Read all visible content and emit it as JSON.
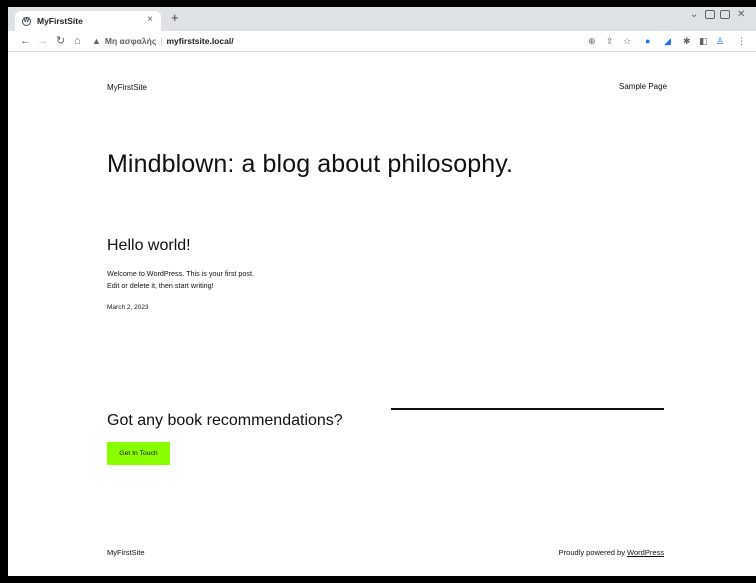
{
  "browser": {
    "tab": {
      "title": "MyFirstSite",
      "close": "×"
    },
    "new_tab": "+",
    "omnibox": {
      "security_label": "Μη ασφαλής",
      "separator": "|",
      "url": "myfirstsite.local/"
    }
  },
  "site": {
    "title": "MyFirstSite",
    "nav": [
      "Sample Page"
    ],
    "hero": "Mindblown: a blog about philosophy.",
    "post": {
      "title": "Hello world!",
      "excerpt_line1": "Welcome to WordPress. This is your first post.",
      "excerpt_line2": "Edit or delete it, then start writing!",
      "date": "March 2, 2023"
    },
    "cta": {
      "heading": "Got any book recommendations?",
      "button": "Get In Touch",
      "button_color": "#8aff00"
    },
    "footer": {
      "title": "MyFirstSite",
      "powered_prefix": "Proudly powered by ",
      "powered_link": "WordPress"
    }
  }
}
